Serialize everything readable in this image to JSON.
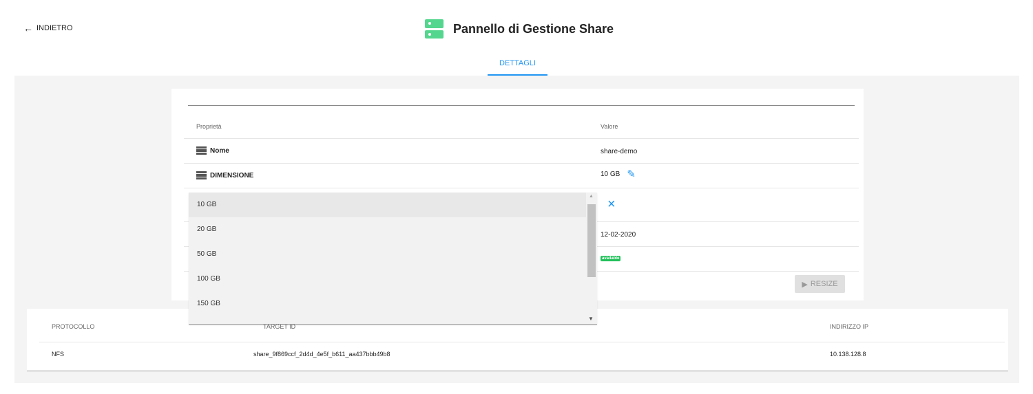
{
  "header": {
    "back_label": "INDIETRO",
    "title": "Pannello di Gestione Share",
    "tab": "DETTAGLI"
  },
  "properties": {
    "col_property": "Proprietà",
    "col_value": "Valore",
    "name_label": "Nome",
    "name_value": "share-demo",
    "size_label": "DIMENSIONE",
    "size_value": "10 GB",
    "date_value": "12-02-2020",
    "status_value": "available",
    "resize_label": "RESIZE"
  },
  "dropdown": {
    "options": [
      "10 GB",
      "20 GB",
      "50 GB",
      "100 GB",
      "150 GB"
    ],
    "selected": "10 GB"
  },
  "exports": {
    "headers": [
      "PROTOCOLLO",
      "TARGET ID",
      "INDIRIZZO IP"
    ],
    "rows": [
      {
        "protocol": "NFS",
        "target_id": "share_9f869ccf_2d4d_4e5f_b611_aa437bbb49b8",
        "ip": "10.138.128.8"
      }
    ]
  },
  "colors": {
    "accent": "#2196f3",
    "status_green": "#21c05a",
    "icon_green": "#54d68e"
  }
}
